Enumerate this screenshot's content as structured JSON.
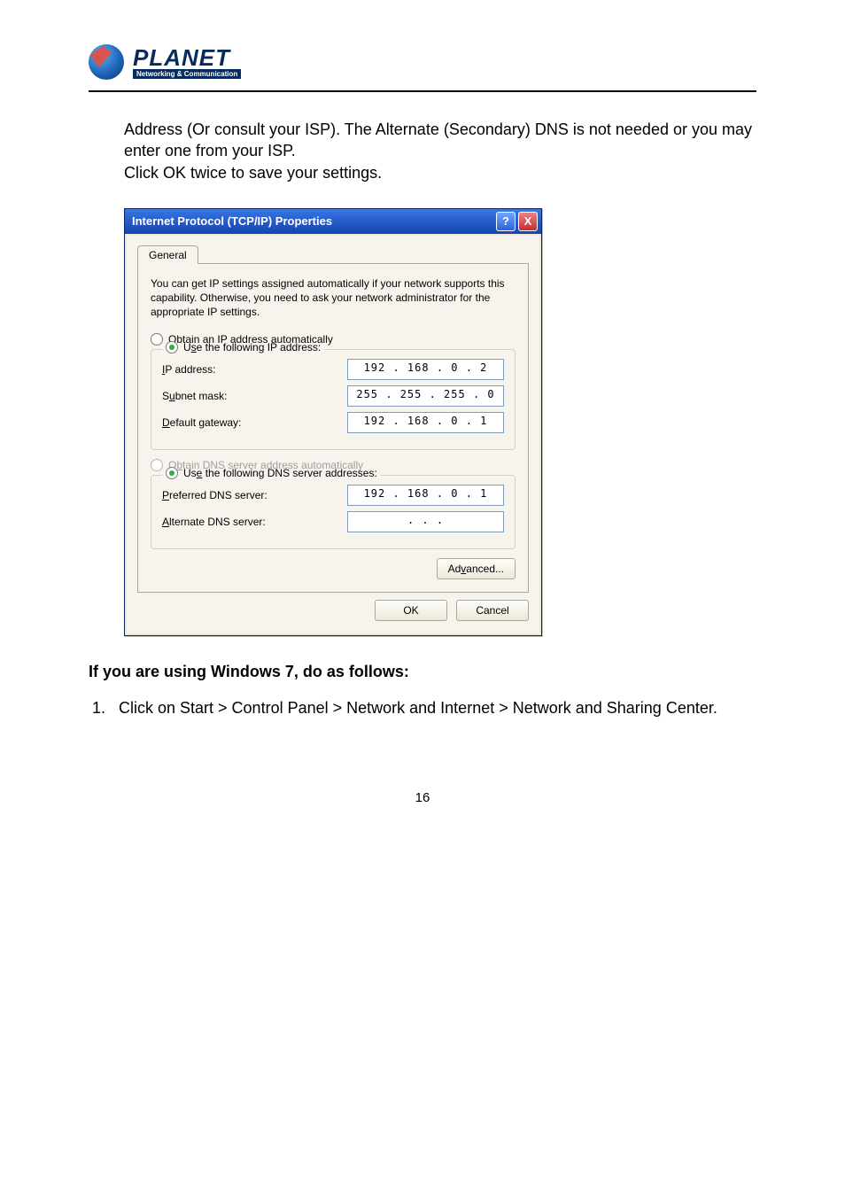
{
  "logo": {
    "title": "PLANET",
    "subtitle": "Networking & Communication"
  },
  "paragraph": {
    "line1": "Address (Or consult your ISP). The Alternate (Secondary) DNS is not needed or you may enter one from your ISP.",
    "line2": "Click OK twice to save your settings."
  },
  "dialog": {
    "title": "Internet Protocol (TCP/IP) Properties",
    "help_symbol": "?",
    "close_symbol": "X",
    "tab": "General",
    "description": "You can get IP settings assigned automatically if your network supports this capability. Otherwise, you need to ask your network administrator for the appropriate IP settings.",
    "radios": {
      "obtain_ip": "Obtain an IP address automatically",
      "use_ip": "Use the following IP address:",
      "obtain_dns": "Obtain DNS server address automatically",
      "use_dns": "Use the following DNS server addresses:"
    },
    "fields": {
      "ip_label": "IP address:",
      "ip_value": "192 . 168 .  0  .  2",
      "mask_label": "Subnet mask:",
      "mask_value": "255 . 255 . 255 .  0",
      "gw_label": "Default gateway:",
      "gw_value": "192 . 168 .  0  .  1",
      "pdns_label": "Preferred DNS server:",
      "pdns_value": "192 . 168 .  0  .  1",
      "adns_label": "Alternate DNS server:",
      "adns_value": " .       .       . "
    },
    "buttons": {
      "advanced": "Advanced...",
      "ok": "OK",
      "cancel": "Cancel"
    }
  },
  "heading": "If you are using Windows 7, do as follows:",
  "step1": "Click on Start > Control Panel > Network and Internet > Network and Sharing Center.",
  "page_number": "16"
}
